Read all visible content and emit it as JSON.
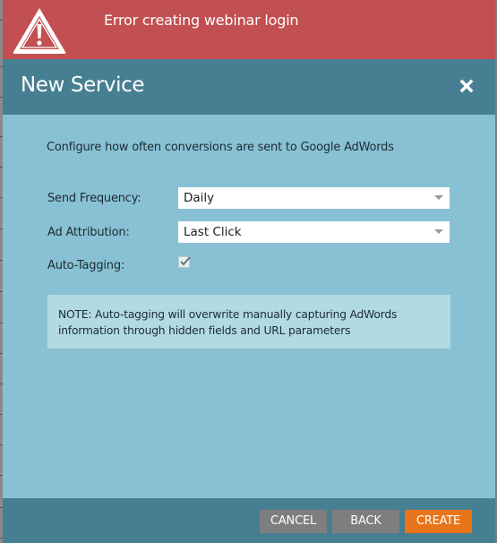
{
  "error_banner": {
    "icon": "warning-triangle-icon",
    "message": "Error creating webinar login",
    "color": "#c24f51"
  },
  "dialog": {
    "title": "New Service",
    "close_icon": "close-icon",
    "intro": "Configure how often conversions are sent to Google AdWords",
    "fields": {
      "send_frequency": {
        "label": "Send Frequency:",
        "value": "Daily"
      },
      "ad_attribution": {
        "label": "Ad Attribution:",
        "value": "Last Click"
      },
      "auto_tagging": {
        "label": "Auto-Tagging:",
        "checked": true
      }
    },
    "note": "NOTE:  Auto-tagging will overwrite manually capturing AdWords information through hidden fields and URL parameters",
    "buttons": {
      "cancel": "CANCEL",
      "back": "BACK",
      "create": "CREATE"
    },
    "colors": {
      "header": "#477f92",
      "body": "#88c1d3",
      "note": "#b2dae3",
      "primary_button": "#e8751a",
      "secondary_button": "#7e7e7e"
    }
  }
}
